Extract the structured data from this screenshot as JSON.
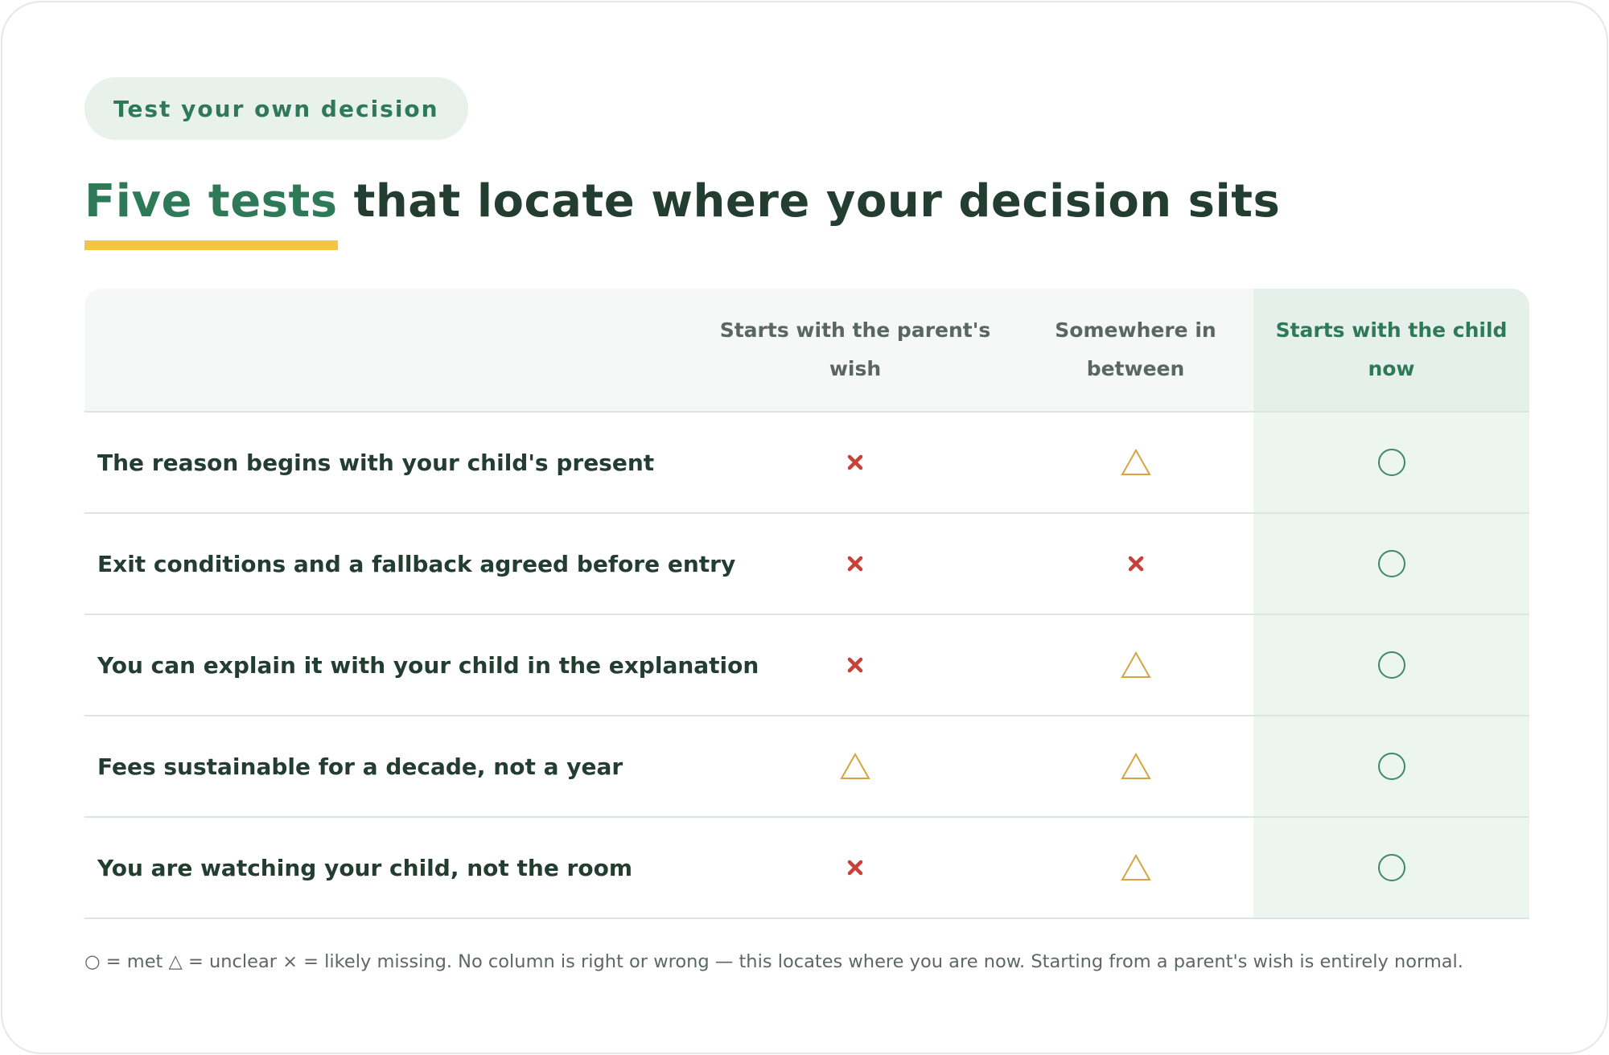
{
  "badge": "Test your own decision",
  "title": {
    "accent": "Five tests",
    "rest": " that locate where your decision sits"
  },
  "table": {
    "columns": [
      "Starts with the parent's wish",
      "Somewhere in between",
      "Starts with the child now"
    ],
    "rows": [
      {
        "label": "The reason begins with your child's present",
        "marks": [
          "cross",
          "triangle",
          "circle"
        ]
      },
      {
        "label": "Exit conditions and a fallback agreed before entry",
        "marks": [
          "cross",
          "cross",
          "circle"
        ]
      },
      {
        "label": "You can explain it with your child in the explanation",
        "marks": [
          "cross",
          "triangle",
          "circle"
        ]
      },
      {
        "label": "Fees sustainable for a decade, not a year",
        "marks": [
          "triangle",
          "triangle",
          "circle"
        ]
      },
      {
        "label": "You are watching your child, not the room",
        "marks": [
          "cross",
          "triangle",
          "circle"
        ]
      }
    ]
  },
  "footnote": "○ = met △ = unclear × = likely missing. No column is right or wrong — this locates where you are now. Starting from a parent's wish is entirely normal.",
  "colors": {
    "accent": "#2e7a58",
    "underline": "#f6c444",
    "cross": "#c94038",
    "triangle": "#d6a441",
    "circle": "#3f8a66"
  },
  "icons": {
    "cross": "cross-icon",
    "triangle": "triangle-icon",
    "circle": "circle-icon"
  }
}
